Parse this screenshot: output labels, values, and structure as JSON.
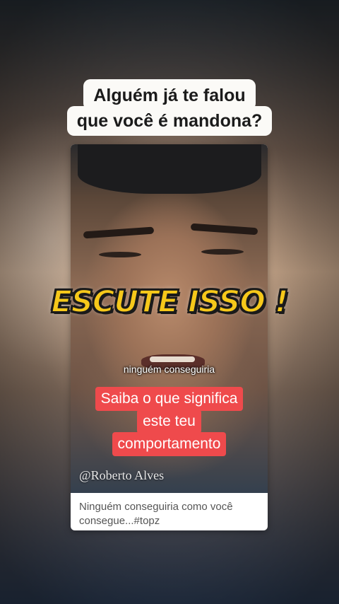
{
  "headline": {
    "line1": "Alguém já te falou",
    "line2": "que você é mandona?"
  },
  "overlay_title": "ESCUTE ISSO !",
  "video": {
    "subtitle": "ninguém conseguiria",
    "red_lines": [
      "Saiba o que significa",
      "este teu",
      "comportamento"
    ],
    "watermark": "@Roberto Alves"
  },
  "caption": "Ninguém conseguiria como você consegue...#topz"
}
